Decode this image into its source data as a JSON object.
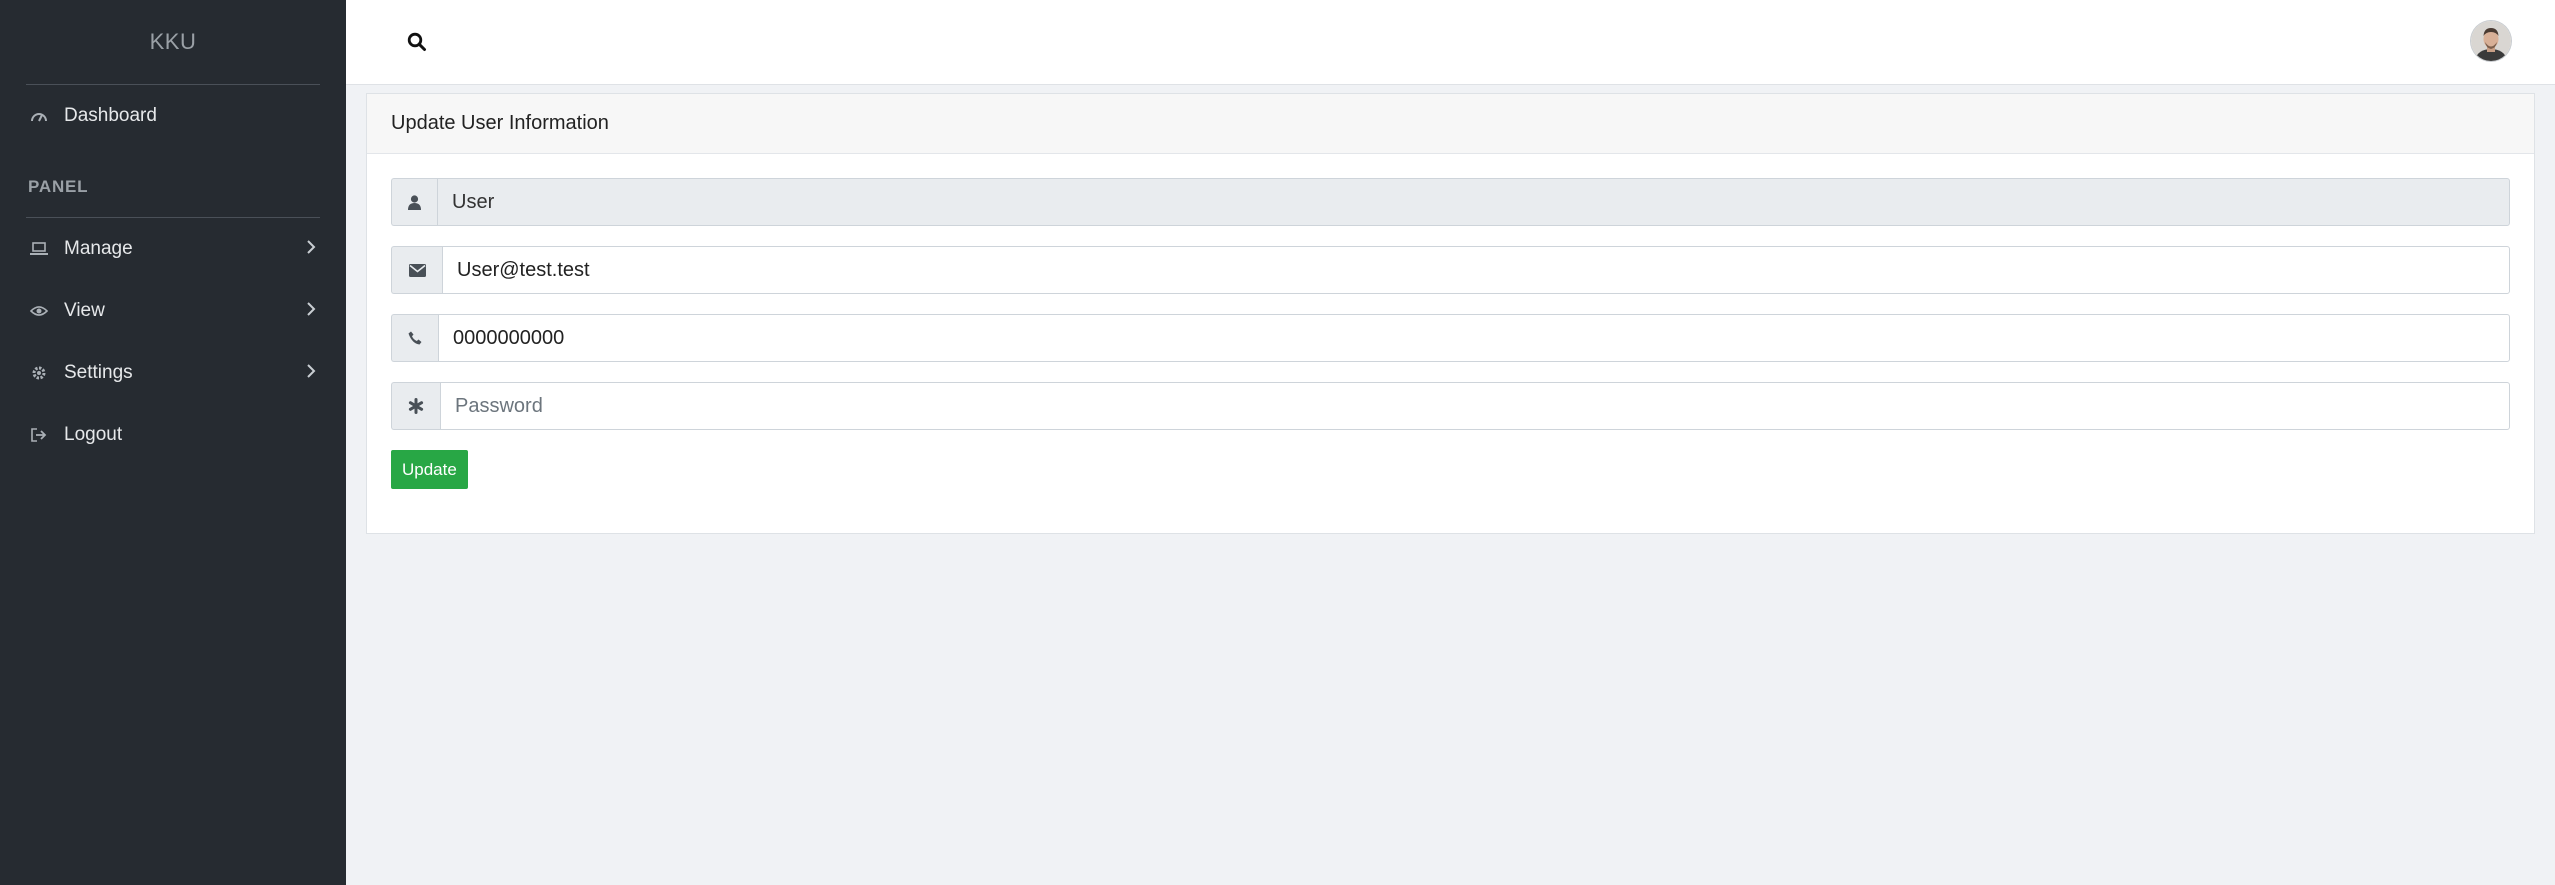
{
  "brand": "KKU",
  "sidebar": {
    "items_top": [
      {
        "label": "Dashboard",
        "icon": "dashboard-icon"
      }
    ],
    "section_label": "PANEL",
    "items_panel": [
      {
        "label": "Manage",
        "icon": "laptop-icon",
        "has_submenu": true
      },
      {
        "label": "View",
        "icon": "eye-icon",
        "has_submenu": true
      },
      {
        "label": "Settings",
        "icon": "gear-icon",
        "has_submenu": true
      },
      {
        "label": "Logout",
        "icon": "sign-out-icon",
        "has_submenu": false
      }
    ]
  },
  "topbar": {
    "search_icon": "search-icon",
    "avatar": "user-avatar"
  },
  "card": {
    "title": "Update User Information",
    "fields": {
      "username": {
        "value": "User",
        "icon": "user-icon",
        "readonly": true
      },
      "email": {
        "value": "User@test.test",
        "icon": "envelope-icon"
      },
      "phone": {
        "value": "0000000000",
        "icon": "phone-icon"
      },
      "password": {
        "value": "",
        "placeholder": "Password",
        "icon": "asterisk-icon"
      }
    },
    "submit_label": "Update"
  },
  "colors": {
    "sidebar_bg": "#262b31",
    "page_bg": "#f0f2f5",
    "accent_green": "#28a745"
  }
}
